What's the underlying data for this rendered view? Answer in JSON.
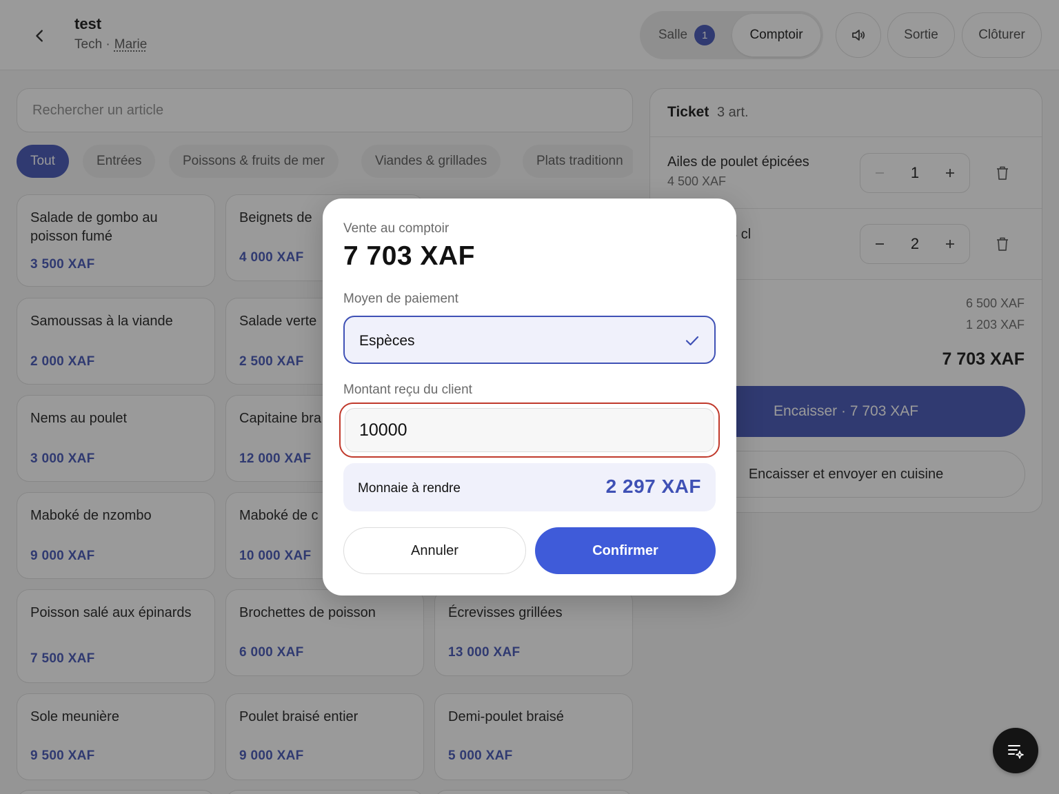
{
  "header": {
    "title": "test",
    "subtitle_prefix": "Tech ·",
    "user": "Marie",
    "modes": {
      "salle_label": "Salle",
      "salle_badge": "1",
      "comptoir_label": "Comptoir"
    },
    "exit_label": "Sortie",
    "close_label": "Clôturer",
    "icons": {
      "back": "chevron-left-icon",
      "sound": "speaker-icon"
    }
  },
  "search": {
    "placeholder": "Rechercher un article",
    "value": ""
  },
  "categories": [
    "Tout",
    "Entrées",
    "Poissons & fruits de mer",
    "Viandes & grillades",
    "Plats traditionn"
  ],
  "active_category": "Tout",
  "products": [
    {
      "name": "Salade de gombo au poisson fumé",
      "price": "3 500 XAF"
    },
    {
      "name": "Beignets de",
      "price": "4 000 XAF"
    },
    {
      "name": "Samoussas à la viande",
      "price": "2 000 XAF"
    },
    {
      "name": "Salade verte",
      "price": "2 500 XAF"
    },
    {
      "name": "Nems au poulet",
      "price": "3 000 XAF"
    },
    {
      "name": "Capitaine bra",
      "price": "12 000 XAF"
    },
    {
      "name": "Maboké de nzombo",
      "price": "9 000 XAF"
    },
    {
      "name": "Maboké de c",
      "price": "10 000 XAF"
    },
    {
      "name": "Poisson salé aux épinards",
      "price": "7 500 XAF"
    },
    {
      "name": "Brochettes de poisson",
      "price": "6 000 XAF"
    },
    {
      "name": "Écrevisses grillées",
      "price": "13 000 XAF"
    },
    {
      "name": "Sole meunière",
      "price": "9 500 XAF"
    },
    {
      "name": "Poulet braisé entier",
      "price": "9 000 XAF"
    },
    {
      "name": "Demi-poulet braisé",
      "price": "5 000 XAF"
    }
  ],
  "ticket": {
    "title": "Ticket",
    "count": "3 art.",
    "lines": [
      {
        "name": "Ailes de poulet épicées",
        "price": "4 500 XAF",
        "qty": "1"
      },
      {
        "name": "33 cl",
        "price": "",
        "qty": "2"
      }
    ],
    "subtotal": "6 500 XAF",
    "tax": "1 203 XAF",
    "total": "7 703 XAF",
    "pay_label": "Encaisser · 7 703 XAF",
    "pay_kitchen_label": "Encaisser et envoyer en cuisine",
    "icons": {
      "delete": "trash-icon",
      "minus": "minus-icon",
      "plus": "plus-icon"
    }
  },
  "fab": {
    "icon": "list-sparkle-icon"
  },
  "modal": {
    "subtitle": "Vente au comptoir",
    "amount": "7 703 XAF",
    "payment_label": "Moyen de paiement",
    "payment_method": "Espèces",
    "received_label": "Montant reçu du client",
    "received_value": "10000",
    "change_label": "Monnaie à rendre",
    "change_value": "2 297 XAF",
    "cancel_label": "Annuler",
    "confirm_label": "Confirmer",
    "icons": {
      "selected": "check-icon"
    }
  },
  "colors": {
    "accent": "#3f51b5",
    "error_outline": "#c0392b",
    "overlay": "#1e1e1e"
  }
}
